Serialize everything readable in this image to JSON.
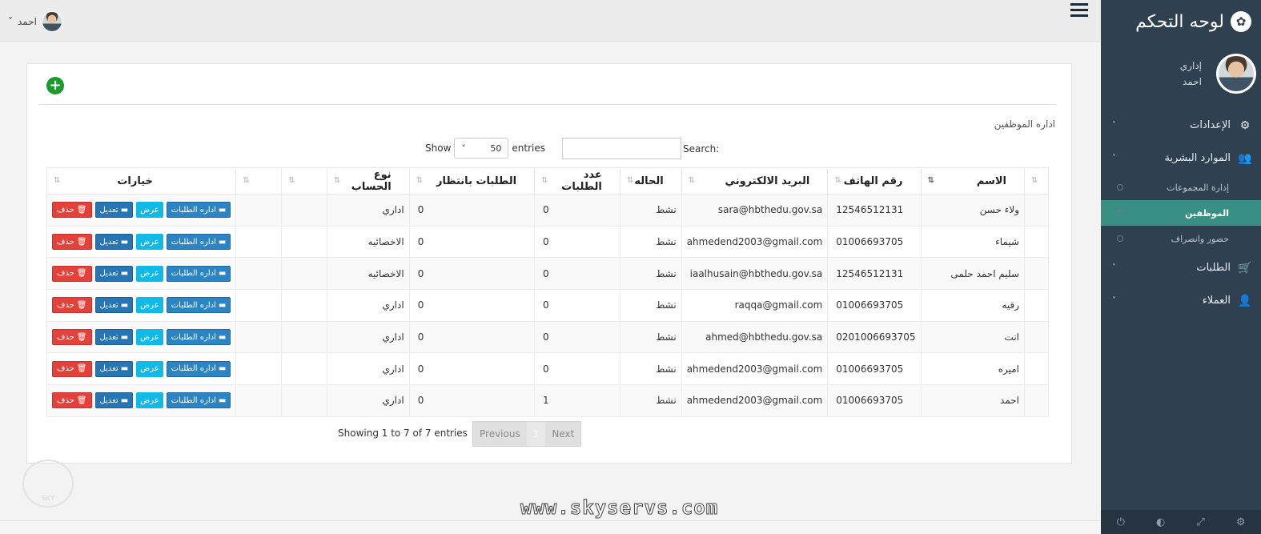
{
  "brand": {
    "title": "لوحه التحكم",
    "icon": "paw-icon"
  },
  "profile": {
    "role": "إداري",
    "name": "احمد"
  },
  "sidebar": {
    "items": [
      {
        "label": "الإعدادات",
        "icon": "gears-icon"
      },
      {
        "label": "الموارد البشرية",
        "icon": "users-icon",
        "children": [
          {
            "label": "إدارة المجموعات"
          },
          {
            "label": "الموظفين",
            "active": true
          },
          {
            "label": "حضور وانصراف"
          }
        ]
      },
      {
        "label": "الطلبات",
        "icon": "cart-icon"
      },
      {
        "label": "العملاء",
        "icon": "user-icon"
      }
    ]
  },
  "topbar": {
    "user_name": "احمد"
  },
  "panel": {
    "title": "اداره الموظفين",
    "search_label": "Search:",
    "show_label": "Show",
    "entries_label": "entries",
    "page_length": "50",
    "info": "Showing 1 to 7 of 7 entries",
    "prev": "Previous",
    "page": "1",
    "next": "Next"
  },
  "table": {
    "headers": [
      "الاسم",
      "رقم الهاتف",
      "البريد الالكتروني",
      "الحاله",
      "عدد الطلبات",
      "الطلبات بانتظار",
      "نوع الحساب",
      "",
      "",
      "خيارات"
    ],
    "buttons": {
      "requests": "اداره الطلبات",
      "view": "عرض",
      "edit": "تعديل",
      "delete": "حذف"
    },
    "rows": [
      {
        "name": "ولاء حسن",
        "phone": "12546512131",
        "email": "sara@hbthedu.gov.sa",
        "status": "نشط",
        "orders": "0",
        "pending": "0",
        "type": "اداري"
      },
      {
        "name": "شيماء",
        "phone": "01006693705",
        "email": "ahmedend2003@gmail.com",
        "status": "نشط",
        "orders": "0",
        "pending": "0",
        "type": "الاخصائيه"
      },
      {
        "name": "سليم احمد حلمى",
        "phone": "12546512131",
        "email": "iaalhusain@hbthedu.gov.sa",
        "status": "نشط",
        "orders": "0",
        "pending": "0",
        "type": "الاخصائيه"
      },
      {
        "name": "رقيه",
        "phone": "01006693705",
        "email": "raqqa@gmail.com",
        "status": "نشط",
        "orders": "0",
        "pending": "0",
        "type": "اداري"
      },
      {
        "name": "انت",
        "phone": "0201006693705",
        "email": "ahmed@hbthedu.gov.sa",
        "status": "نشط",
        "orders": "0",
        "pending": "0",
        "type": "اداري"
      },
      {
        "name": "اميره",
        "phone": "01006693705",
        "email": "ahmedend2003@gmail.com",
        "status": "نشط",
        "orders": "0",
        "pending": "0",
        "type": "اداري"
      },
      {
        "name": "احمد",
        "phone": "01006693705",
        "email": "ahmedend2003@gmail.com",
        "status": "نشط",
        "orders": "1",
        "pending": "0",
        "type": "اداري"
      }
    ]
  },
  "watermark": {
    "text": "www.skyservs.com"
  }
}
